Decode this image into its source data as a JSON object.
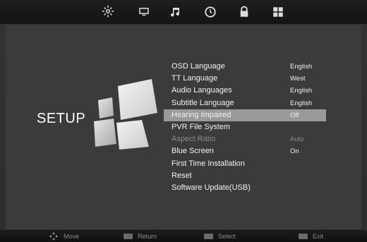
{
  "title": "SETUP",
  "top_icons": [
    {
      "name": "settings-icon",
      "active": true
    },
    {
      "name": "picture-icon",
      "active": false
    },
    {
      "name": "sound-icon",
      "active": false
    },
    {
      "name": "clock-icon",
      "active": false
    },
    {
      "name": "lock-icon",
      "active": false
    },
    {
      "name": "setup-icon",
      "active": false
    }
  ],
  "menu": [
    {
      "label": "OSD Language",
      "value": "English"
    },
    {
      "label": "TT Language",
      "value": "West"
    },
    {
      "label": "Audio Languages",
      "value": "English"
    },
    {
      "label": "Subtitle Language",
      "value": "English"
    },
    {
      "label": "Hearing Impaired",
      "value": "Off",
      "selected": true
    },
    {
      "label": "PVR File System",
      "value": ""
    },
    {
      "label": "Aspect Ratio",
      "value": "Auto",
      "disabled": true
    },
    {
      "label": "Blue Screen",
      "value": "On"
    },
    {
      "label": "First Time Installation",
      "value": ""
    },
    {
      "label": "Reset",
      "value": ""
    },
    {
      "label": "Software Update(USB)",
      "value": ""
    }
  ],
  "bottom": {
    "move": "Move",
    "return": "Return",
    "select": "Select",
    "exit": "Exit"
  }
}
